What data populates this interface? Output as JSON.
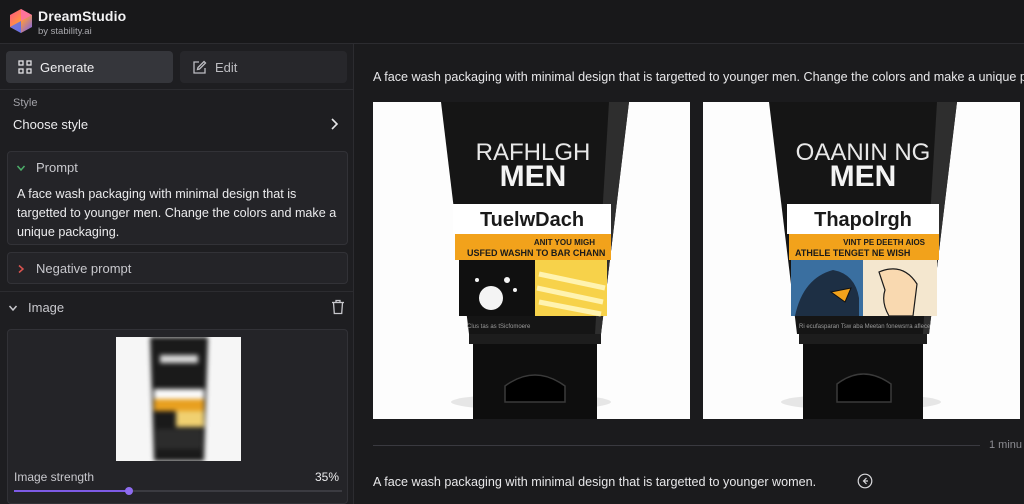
{
  "app": {
    "name": "DreamStudio",
    "subtitle": "by stability.ai",
    "logo_icon": "dreamstudio-logo-icon"
  },
  "sidebar": {
    "modes": [
      {
        "label": "Generate",
        "icon": "grid-icon",
        "active": true
      },
      {
        "label": "Edit",
        "icon": "edit-icon",
        "active": false
      }
    ],
    "style": {
      "label": "Style",
      "value": "Choose style",
      "icon": "chevron-right-icon"
    },
    "prompt": {
      "label": "Prompt",
      "text": "A face wash packaging with minimal design that is targetted to younger men. Change the colors and make a unique packaging.",
      "expanded": true
    },
    "negative_prompt": {
      "label": "Negative prompt",
      "expanded": false
    },
    "image": {
      "label": "Image",
      "strength_label": "Image strength",
      "strength_value": "35%",
      "strength_fraction": 0.35,
      "delete_icon": "trash-icon"
    }
  },
  "main": {
    "current_prompt": "A face wash packaging with minimal design that is targetted to younger men. Change the colors and make a unique packaging.",
    "results": [
      {
        "brand": "RAFHLGH",
        "line": "MEN",
        "band_title": "TuelwDach",
        "band_a": "ANIT YOU MIGH",
        "band_b": "USFED WASHN TO BAR CHANN",
        "fine_print": "Clus tas as  tSicfomoere"
      },
      {
        "brand": "OAANIN NG",
        "line": "MEN",
        "band_title": "Thapolrgh",
        "band_a": "VINT PE DEETH AIOS",
        "band_b": "ATHELE TENGET NE WISH",
        "fine_print": "Ri ecufasparan Tsw aba  Meetan fonewsrra aflece"
      }
    ],
    "timestamp": "1 minu",
    "next_prompt": "A face wash packaging with minimal design that is targetted to younger women.",
    "reuse_icon": "arrow-left-circle-icon"
  },
  "colors": {
    "accent": "#8e6cf0",
    "prompt_chevron": "#4caf6a",
    "negative_chevron": "#d9534f",
    "tube": "#161616",
    "band_orange": "#f2a21b"
  }
}
